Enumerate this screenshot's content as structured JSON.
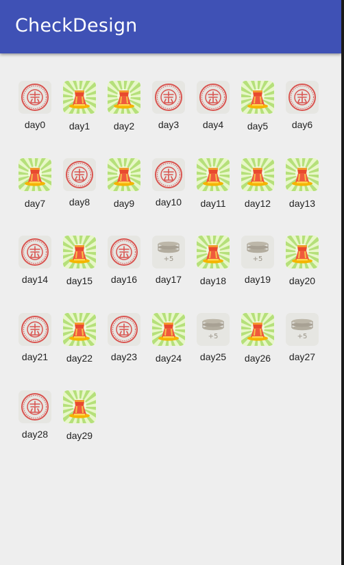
{
  "app": {
    "title": "CheckDesign"
  },
  "colors": {
    "appbar": "#3f51b5",
    "stamp_red": "#d9534f",
    "reward_green": "#9ccc65",
    "coin_gray": "#a8a194"
  },
  "days": [
    {
      "label": "day0",
      "state": "signed",
      "icon": "sign-stamp-icon"
    },
    {
      "label": "day1",
      "state": "reward",
      "icon": "reward-bag-icon"
    },
    {
      "label": "day2",
      "state": "reward",
      "icon": "reward-bag-icon"
    },
    {
      "label": "day3",
      "state": "signed",
      "icon": "sign-stamp-icon"
    },
    {
      "label": "day4",
      "state": "signed",
      "icon": "sign-stamp-icon"
    },
    {
      "label": "day5",
      "state": "reward",
      "icon": "reward-bag-icon"
    },
    {
      "label": "day6",
      "state": "signed",
      "icon": "sign-stamp-icon"
    },
    {
      "label": "day7",
      "state": "reward",
      "icon": "reward-bag-icon"
    },
    {
      "label": "day8",
      "state": "signed",
      "icon": "sign-stamp-icon"
    },
    {
      "label": "day9",
      "state": "reward",
      "icon": "reward-bag-icon"
    },
    {
      "label": "day10",
      "state": "signed",
      "icon": "sign-stamp-icon"
    },
    {
      "label": "day11",
      "state": "reward",
      "icon": "reward-bag-icon"
    },
    {
      "label": "day12",
      "state": "reward",
      "icon": "reward-bag-icon"
    },
    {
      "label": "day13",
      "state": "reward",
      "icon": "reward-bag-icon"
    },
    {
      "label": "day14",
      "state": "signed",
      "icon": "sign-stamp-icon"
    },
    {
      "label": "day15",
      "state": "reward",
      "icon": "reward-bag-icon"
    },
    {
      "label": "day16",
      "state": "signed",
      "icon": "sign-stamp-icon"
    },
    {
      "label": "day17",
      "state": "coins",
      "icon": "coin-stack-icon",
      "bonus": "+5"
    },
    {
      "label": "day18",
      "state": "reward",
      "icon": "reward-bag-icon"
    },
    {
      "label": "day19",
      "state": "coins",
      "icon": "coin-stack-icon",
      "bonus": "+5"
    },
    {
      "label": "day20",
      "state": "reward",
      "icon": "reward-bag-icon"
    },
    {
      "label": "day21",
      "state": "signed",
      "icon": "sign-stamp-icon"
    },
    {
      "label": "day22",
      "state": "reward",
      "icon": "reward-bag-icon"
    },
    {
      "label": "day23",
      "state": "signed",
      "icon": "sign-stamp-icon"
    },
    {
      "label": "day24",
      "state": "reward",
      "icon": "reward-bag-icon"
    },
    {
      "label": "day25",
      "state": "coins",
      "icon": "coin-stack-icon",
      "bonus": "+5"
    },
    {
      "label": "day26",
      "state": "reward",
      "icon": "reward-bag-icon"
    },
    {
      "label": "day27",
      "state": "coins",
      "icon": "coin-stack-icon",
      "bonus": "+5"
    },
    {
      "label": "day28",
      "state": "signed",
      "icon": "sign-stamp-icon"
    },
    {
      "label": "day29",
      "state": "reward",
      "icon": "reward-bag-icon"
    }
  ]
}
